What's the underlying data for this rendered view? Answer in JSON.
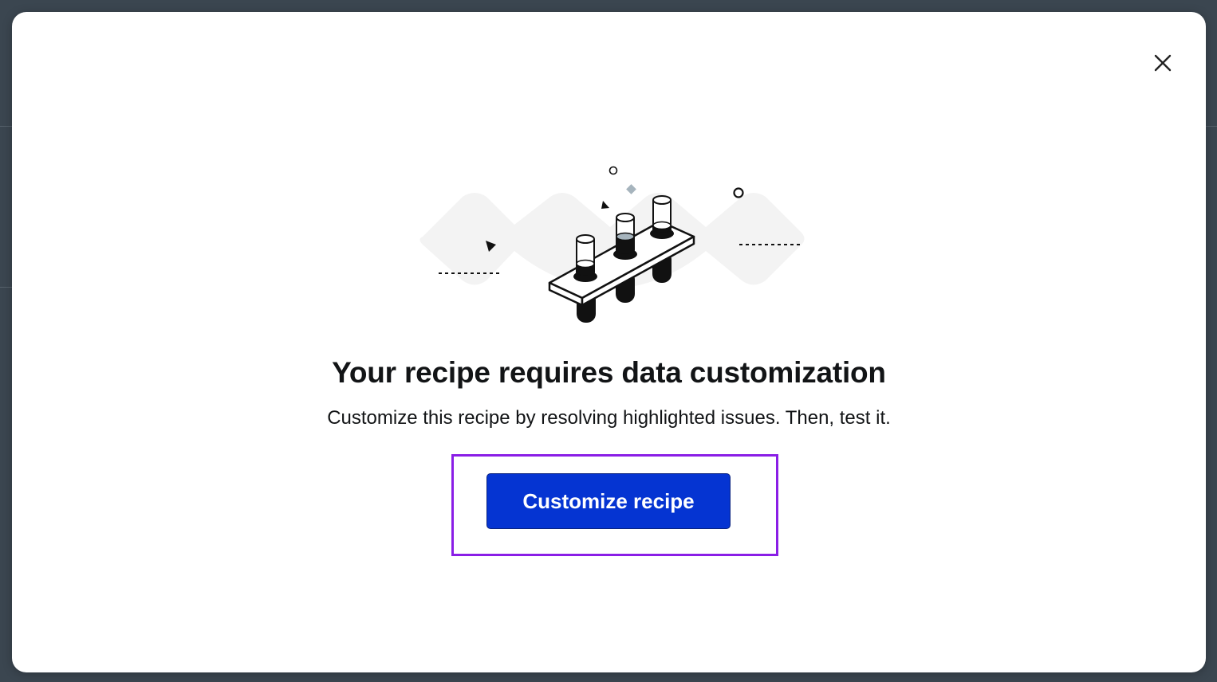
{
  "modal": {
    "title": "Your recipe requires data customization",
    "subtitle": "Customize this recipe by resolving highlighted issues. Then, test it.",
    "primary_button_label": "Customize recipe",
    "close_icon": "close-icon",
    "illustration_icon": "test-tubes-illustration"
  },
  "colors": {
    "primary_button": "#0534d2",
    "highlight_border": "#8a1ee6",
    "backdrop": "#3b4650"
  }
}
